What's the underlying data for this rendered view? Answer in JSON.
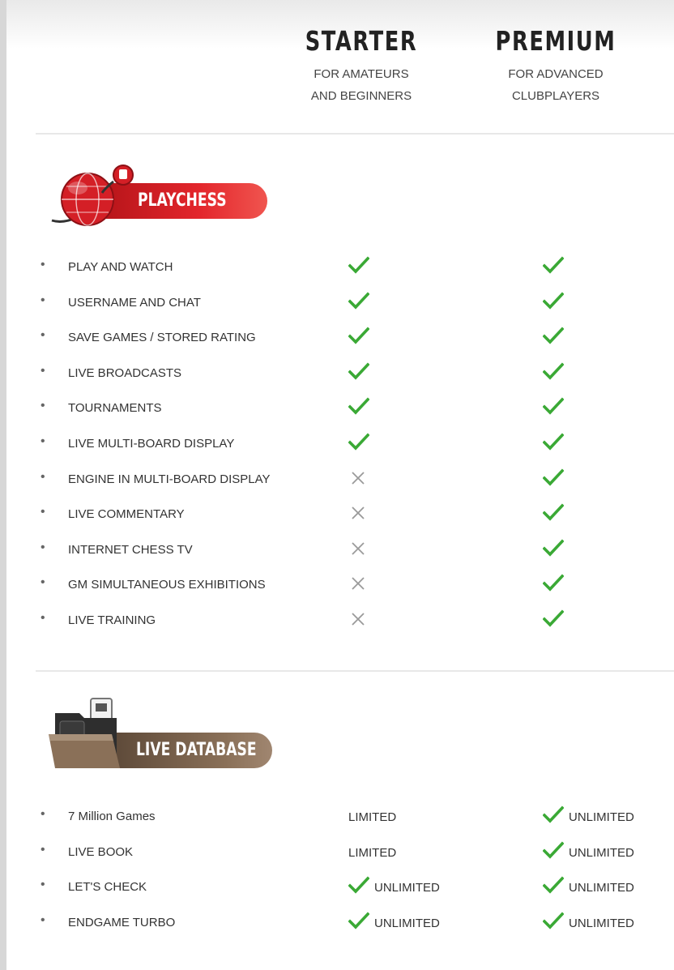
{
  "plans": {
    "starter": {
      "name": "STARTER",
      "line1": "FOR AMATEURS",
      "line2": "AND BEGINNERS"
    },
    "premium": {
      "name": "PREMIUM",
      "line1": "FOR ADVANCED",
      "line2": "CLUBPLAYERS"
    }
  },
  "sections": {
    "playchess": {
      "label": "PLAYCHESS",
      "features": [
        {
          "label": "PLAY AND WATCH",
          "starter": "check",
          "premium": "check"
        },
        {
          "label": "USERNAME AND CHAT",
          "starter": "check",
          "premium": "check"
        },
        {
          "label": "SAVE GAMES / STORED RATING",
          "starter": "check",
          "premium": "check"
        },
        {
          "label": "LIVE BROADCASTS",
          "starter": "check",
          "premium": "check"
        },
        {
          "label": "TOURNAMENTS",
          "starter": "check",
          "premium": "check"
        },
        {
          "label": "LIVE MULTI-BOARD DISPLAY",
          "starter": "check",
          "premium": "check"
        },
        {
          "label": "ENGINE IN MULTI-BOARD DISPLAY",
          "starter": "cross",
          "premium": "check"
        },
        {
          "label": "LIVE COMMENTARY",
          "starter": "cross",
          "premium": "check"
        },
        {
          "label": "INTERNET CHESS TV",
          "starter": "cross",
          "premium": "check"
        },
        {
          "label": "GM SIMULTANEOUS EXHIBITIONS",
          "starter": "cross",
          "premium": "check"
        },
        {
          "label": "LIVE TRAINING",
          "starter": "cross",
          "premium": "check"
        }
      ]
    },
    "livedatabase": {
      "label": "LIVE DATABASE",
      "features": [
        {
          "label": "7 Million Games",
          "starter": "LIMITED",
          "starter_check": false,
          "premium": "UNLIMITED",
          "premium_check": true
        },
        {
          "label": "LIVE BOOK",
          "starter": "LIMITED",
          "starter_check": false,
          "premium": "UNLIMITED",
          "premium_check": true
        },
        {
          "label": "LET'S CHECK",
          "starter": "UNLIMITED",
          "starter_check": true,
          "premium": "UNLIMITED",
          "premium_check": true
        },
        {
          "label": "ENDGAME TURBO",
          "starter": "UNLIMITED",
          "starter_check": true,
          "premium": "UNLIMITED",
          "premium_check": true
        }
      ]
    }
  },
  "colors": {
    "check": "#3aa935",
    "cross": "#9a9a9a",
    "playchess_red": "#d71f26",
    "database_brown": "#7b6450"
  }
}
